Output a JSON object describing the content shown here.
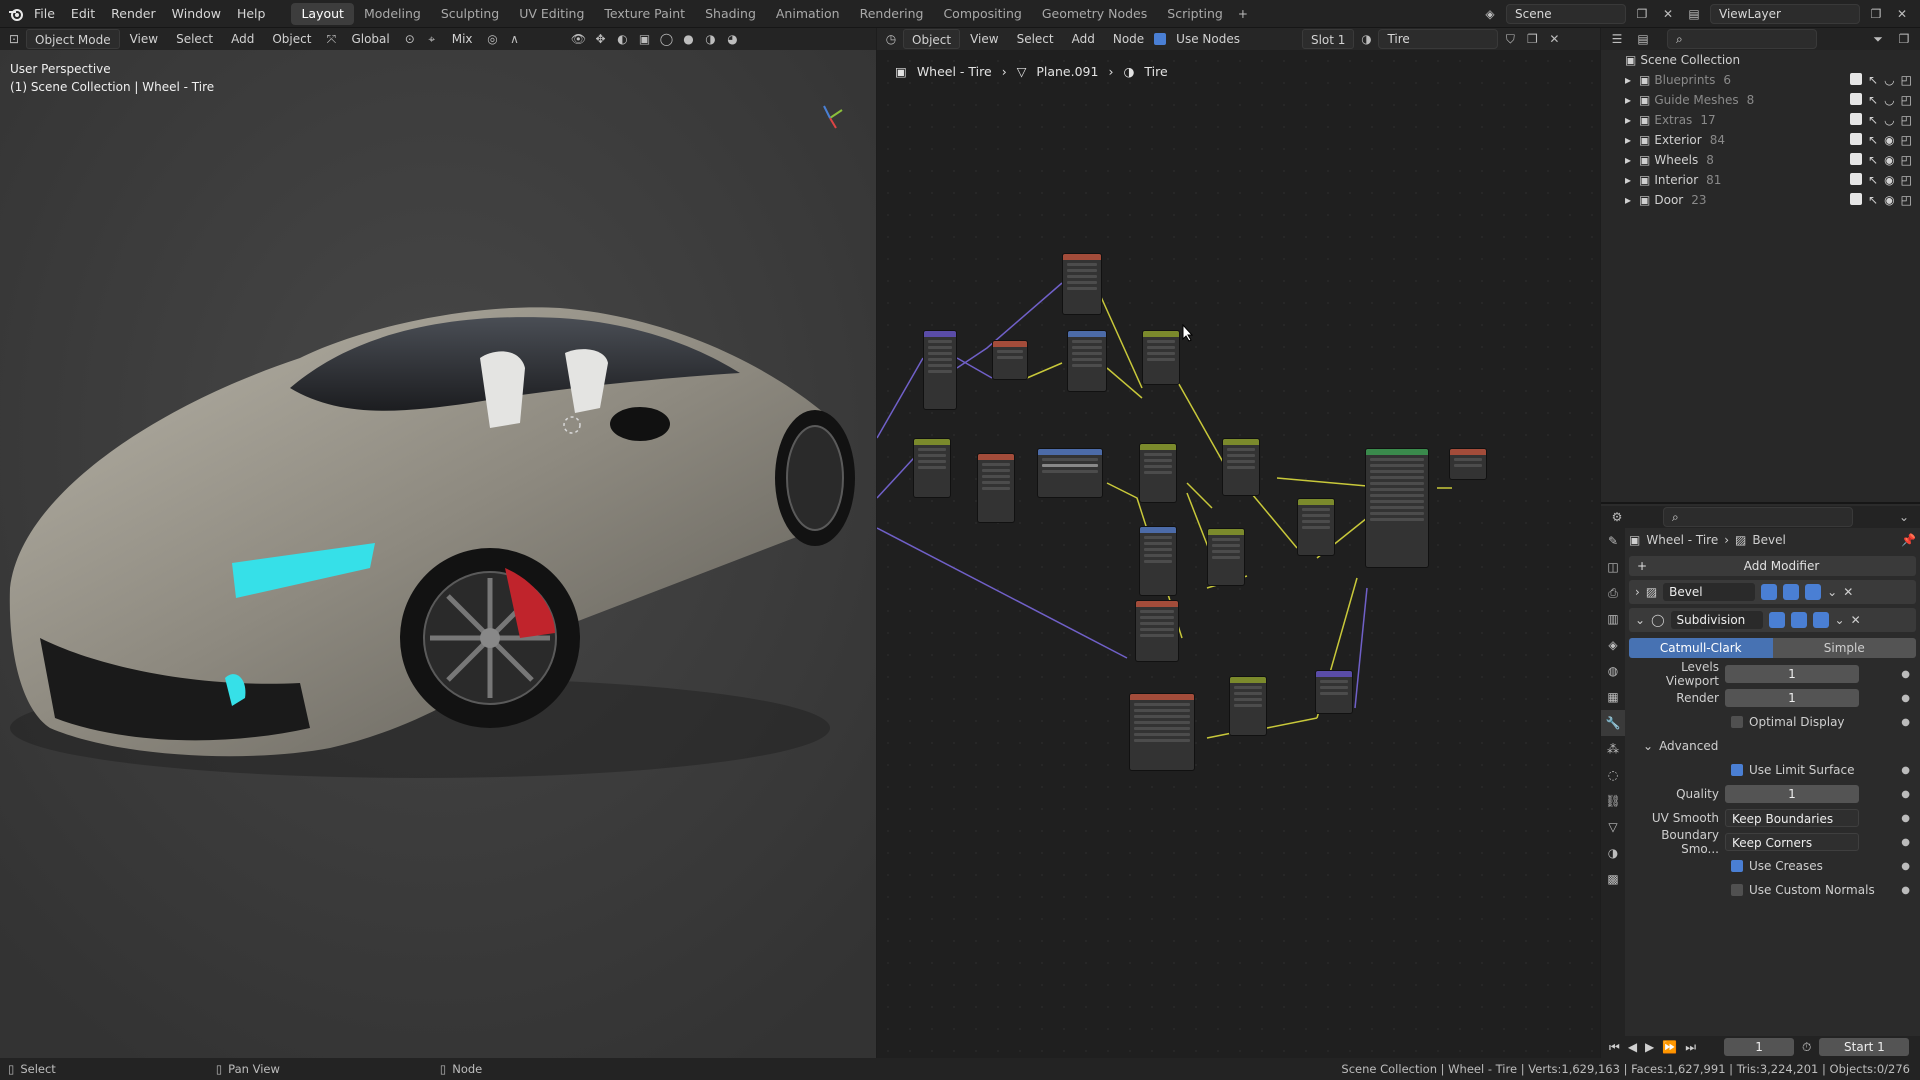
{
  "menu": [
    "File",
    "Edit",
    "Render",
    "Window",
    "Help"
  ],
  "workspaces": [
    "Layout",
    "Modeling",
    "Sculpting",
    "UV Editing",
    "Texture Paint",
    "Shading",
    "Animation",
    "Rendering",
    "Compositing",
    "Geometry Nodes",
    "Scripting"
  ],
  "active_workspace": "Layout",
  "scene": "Scene",
  "view_layer": "ViewLayer",
  "viewport": {
    "mode": "Object Mode",
    "menus": [
      "View",
      "Select",
      "Add",
      "Object"
    ],
    "transform": "Global",
    "snap": "Mix",
    "perspective": "User Perspective",
    "collection_label": "(1) Scene Collection | Wheel - Tire"
  },
  "node_editor": {
    "object_type": "Object",
    "menus": [
      "View",
      "Select",
      "Add",
      "Node"
    ],
    "use_nodes": "Use Nodes",
    "slot": "Slot 1",
    "material": "Tire",
    "breadcrumbs": [
      "Wheel - Tire",
      "Plane.091",
      "Tire"
    ]
  },
  "outliner": {
    "root": "Scene Collection",
    "items": [
      {
        "name": "Blueprints",
        "count": "6",
        "dim": true
      },
      {
        "name": "Guide Meshes",
        "count": "8",
        "dim": true
      },
      {
        "name": "Extras",
        "count": "17",
        "dim": true
      },
      {
        "name": "Exterior",
        "count": "84",
        "dim": false
      },
      {
        "name": "Wheels",
        "count": "8",
        "dim": false
      },
      {
        "name": "Interior",
        "count": "81",
        "dim": false
      },
      {
        "name": "Door",
        "count": "23",
        "dim": false
      }
    ]
  },
  "properties": {
    "object": "Wheel - Tire",
    "modifier_context": "Bevel",
    "add_modifier": "Add Modifier",
    "modifiers": [
      "Bevel",
      "Subdivision"
    ],
    "subdiv_types": [
      "Catmull-Clark",
      "Simple"
    ],
    "levels_viewport_label": "Levels Viewport",
    "levels_viewport": "1",
    "render_label": "Render",
    "render": "1",
    "optimal_display": "Optimal Display",
    "advanced": "Advanced",
    "use_limit_surface": "Use Limit Surface",
    "quality_label": "Quality",
    "quality": "1",
    "uv_smooth_label": "UV Smooth",
    "uv_smooth": "Keep Boundaries",
    "boundary_label": "Boundary Smo...",
    "boundary": "Keep Corners",
    "use_creases": "Use Creases",
    "use_custom_normals": "Use Custom Normals"
  },
  "timeline": {
    "frame": "1",
    "start_label": "Start",
    "start": "1"
  },
  "status": {
    "left": [
      "Select",
      "Pan View",
      "Node"
    ],
    "right": "Scene Collection | Wheel - Tire | Verts:1,629,163 | Faces:1,627,991 | Tris:3,224,201 | Objects:0/276"
  },
  "colors": {
    "accent": "#4772b3",
    "car_body": "#8e8a80",
    "headlight": "#36e0e8",
    "caliper": "#c0242c"
  }
}
